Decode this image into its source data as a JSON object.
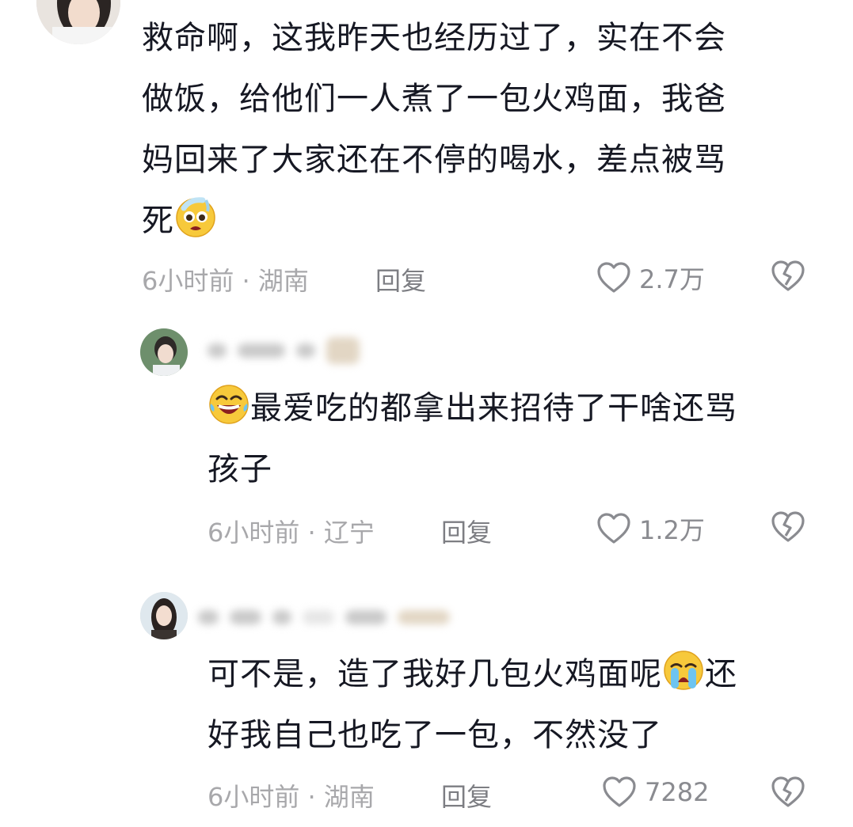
{
  "comments": [
    {
      "text_lines": [
        "救命啊，这我昨天也经历过了，实在不会",
        "做饭，给他们一人煮了一包火鸡面，我爸",
        "妈回来了大家还在不停的喝水，差点被骂",
        "死"
      ],
      "emoji": "pleading-sweat-face-icon",
      "time": "6小时前 · 湖南",
      "reply": "回复",
      "likes": "2.7万"
    },
    {
      "emoji": "rofl-face-icon",
      "text_lines": [
        "最爱吃的都拿出来招待了干啥还骂",
        "孩子"
      ],
      "time": "6小时前 · 辽宁",
      "reply": "回复",
      "likes": "1.2万"
    },
    {
      "text_lines": [
        "可不是，造了我好几包火鸡面呢",
        "还",
        "好我自己也吃了一包，不然没了"
      ],
      "emoji": "loudly-crying-face-icon",
      "time": "6小时前 · 湖南",
      "reply": "回复",
      "likes": "7282"
    }
  ],
  "icons": {
    "like": "heart-outline-icon",
    "dislike": "broken-heart-outline-icon"
  },
  "colors": {
    "text": "#161823",
    "meta": "#a8a8ab",
    "reply": "#7d7e83",
    "icon": "#8a8b90"
  }
}
